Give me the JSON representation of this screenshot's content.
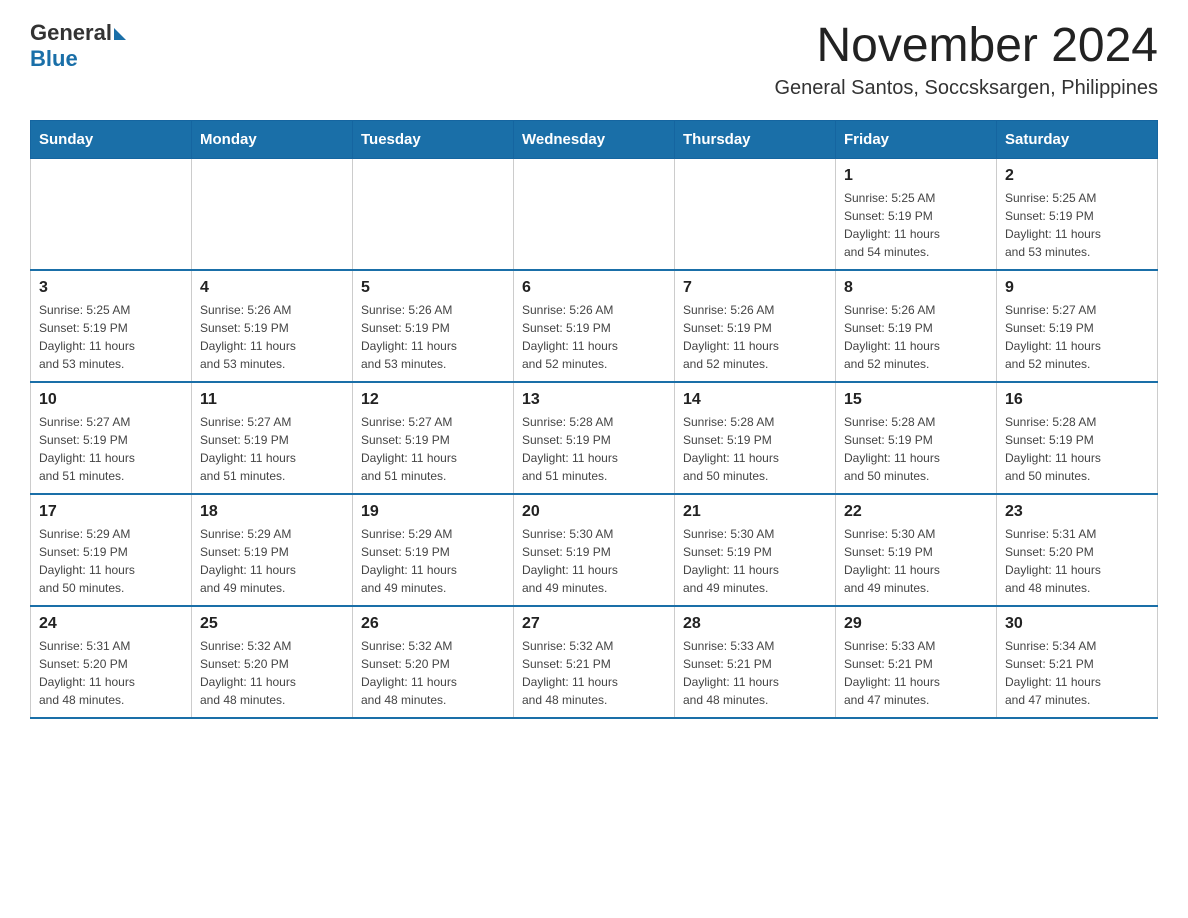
{
  "logo": {
    "general": "General",
    "blue": "Blue"
  },
  "title": "November 2024",
  "subtitle": "General Santos, Soccsksargen, Philippines",
  "weekdays": [
    "Sunday",
    "Monday",
    "Tuesday",
    "Wednesday",
    "Thursday",
    "Friday",
    "Saturday"
  ],
  "weeks": [
    [
      {
        "day": "",
        "info": ""
      },
      {
        "day": "",
        "info": ""
      },
      {
        "day": "",
        "info": ""
      },
      {
        "day": "",
        "info": ""
      },
      {
        "day": "",
        "info": ""
      },
      {
        "day": "1",
        "info": "Sunrise: 5:25 AM\nSunset: 5:19 PM\nDaylight: 11 hours\nand 54 minutes."
      },
      {
        "day": "2",
        "info": "Sunrise: 5:25 AM\nSunset: 5:19 PM\nDaylight: 11 hours\nand 53 minutes."
      }
    ],
    [
      {
        "day": "3",
        "info": "Sunrise: 5:25 AM\nSunset: 5:19 PM\nDaylight: 11 hours\nand 53 minutes."
      },
      {
        "day": "4",
        "info": "Sunrise: 5:26 AM\nSunset: 5:19 PM\nDaylight: 11 hours\nand 53 minutes."
      },
      {
        "day": "5",
        "info": "Sunrise: 5:26 AM\nSunset: 5:19 PM\nDaylight: 11 hours\nand 53 minutes."
      },
      {
        "day": "6",
        "info": "Sunrise: 5:26 AM\nSunset: 5:19 PM\nDaylight: 11 hours\nand 52 minutes."
      },
      {
        "day": "7",
        "info": "Sunrise: 5:26 AM\nSunset: 5:19 PM\nDaylight: 11 hours\nand 52 minutes."
      },
      {
        "day": "8",
        "info": "Sunrise: 5:26 AM\nSunset: 5:19 PM\nDaylight: 11 hours\nand 52 minutes."
      },
      {
        "day": "9",
        "info": "Sunrise: 5:27 AM\nSunset: 5:19 PM\nDaylight: 11 hours\nand 52 minutes."
      }
    ],
    [
      {
        "day": "10",
        "info": "Sunrise: 5:27 AM\nSunset: 5:19 PM\nDaylight: 11 hours\nand 51 minutes."
      },
      {
        "day": "11",
        "info": "Sunrise: 5:27 AM\nSunset: 5:19 PM\nDaylight: 11 hours\nand 51 minutes."
      },
      {
        "day": "12",
        "info": "Sunrise: 5:27 AM\nSunset: 5:19 PM\nDaylight: 11 hours\nand 51 minutes."
      },
      {
        "day": "13",
        "info": "Sunrise: 5:28 AM\nSunset: 5:19 PM\nDaylight: 11 hours\nand 51 minutes."
      },
      {
        "day": "14",
        "info": "Sunrise: 5:28 AM\nSunset: 5:19 PM\nDaylight: 11 hours\nand 50 minutes."
      },
      {
        "day": "15",
        "info": "Sunrise: 5:28 AM\nSunset: 5:19 PM\nDaylight: 11 hours\nand 50 minutes."
      },
      {
        "day": "16",
        "info": "Sunrise: 5:28 AM\nSunset: 5:19 PM\nDaylight: 11 hours\nand 50 minutes."
      }
    ],
    [
      {
        "day": "17",
        "info": "Sunrise: 5:29 AM\nSunset: 5:19 PM\nDaylight: 11 hours\nand 50 minutes."
      },
      {
        "day": "18",
        "info": "Sunrise: 5:29 AM\nSunset: 5:19 PM\nDaylight: 11 hours\nand 49 minutes."
      },
      {
        "day": "19",
        "info": "Sunrise: 5:29 AM\nSunset: 5:19 PM\nDaylight: 11 hours\nand 49 minutes."
      },
      {
        "day": "20",
        "info": "Sunrise: 5:30 AM\nSunset: 5:19 PM\nDaylight: 11 hours\nand 49 minutes."
      },
      {
        "day": "21",
        "info": "Sunrise: 5:30 AM\nSunset: 5:19 PM\nDaylight: 11 hours\nand 49 minutes."
      },
      {
        "day": "22",
        "info": "Sunrise: 5:30 AM\nSunset: 5:19 PM\nDaylight: 11 hours\nand 49 minutes."
      },
      {
        "day": "23",
        "info": "Sunrise: 5:31 AM\nSunset: 5:20 PM\nDaylight: 11 hours\nand 48 minutes."
      }
    ],
    [
      {
        "day": "24",
        "info": "Sunrise: 5:31 AM\nSunset: 5:20 PM\nDaylight: 11 hours\nand 48 minutes."
      },
      {
        "day": "25",
        "info": "Sunrise: 5:32 AM\nSunset: 5:20 PM\nDaylight: 11 hours\nand 48 minutes."
      },
      {
        "day": "26",
        "info": "Sunrise: 5:32 AM\nSunset: 5:20 PM\nDaylight: 11 hours\nand 48 minutes."
      },
      {
        "day": "27",
        "info": "Sunrise: 5:32 AM\nSunset: 5:21 PM\nDaylight: 11 hours\nand 48 minutes."
      },
      {
        "day": "28",
        "info": "Sunrise: 5:33 AM\nSunset: 5:21 PM\nDaylight: 11 hours\nand 48 minutes."
      },
      {
        "day": "29",
        "info": "Sunrise: 5:33 AM\nSunset: 5:21 PM\nDaylight: 11 hours\nand 47 minutes."
      },
      {
        "day": "30",
        "info": "Sunrise: 5:34 AM\nSunset: 5:21 PM\nDaylight: 11 hours\nand 47 minutes."
      }
    ]
  ],
  "colors": {
    "header_bg": "#1a6fa8",
    "header_text": "#ffffff",
    "border": "#1a6fa8",
    "text_primary": "#222222",
    "text_info": "#444444",
    "logo_blue": "#1a6fa8"
  }
}
